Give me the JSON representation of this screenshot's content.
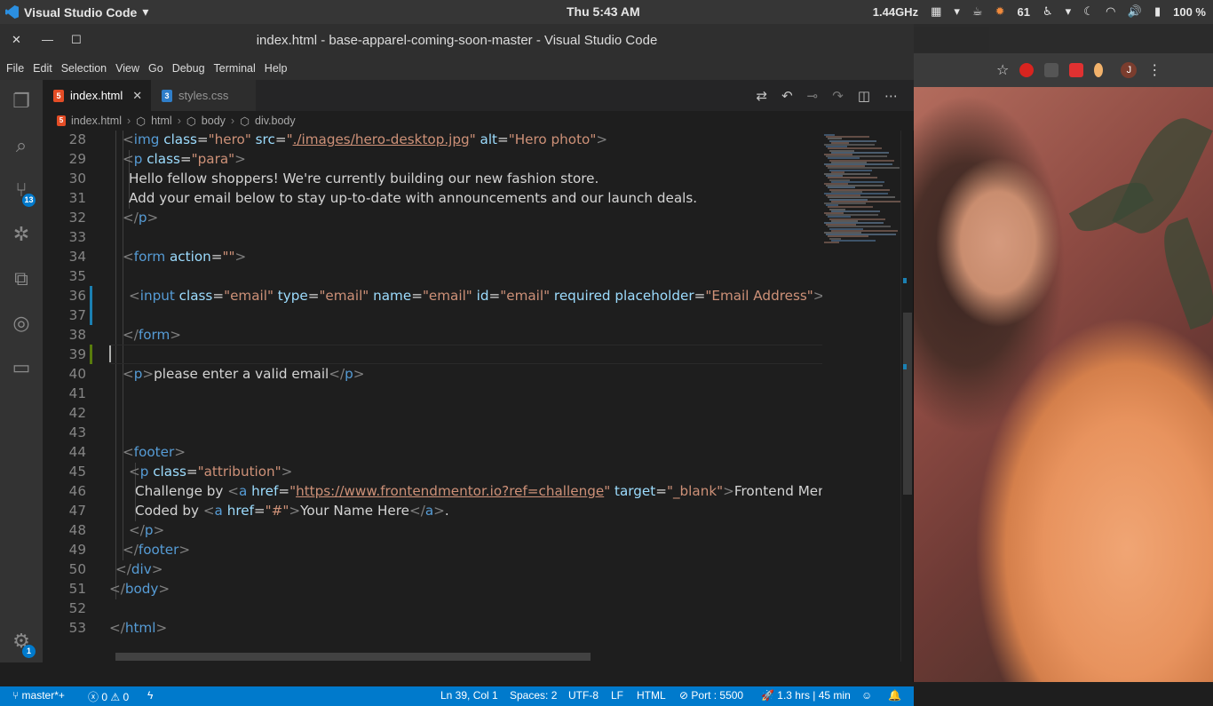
{
  "os": {
    "app_name": "Visual Studio Code",
    "clock": "Thu  5:43 AM",
    "cpu": "1.44GHz",
    "notifications": "61",
    "battery": "100 %"
  },
  "window": {
    "title": "index.html - base-apparel-coming-soon-master - Visual Studio Code",
    "menu": [
      "File",
      "Edit",
      "Selection",
      "View",
      "Go",
      "Debug",
      "Terminal",
      "Help"
    ]
  },
  "activity": {
    "scm_badge": "13",
    "settings_badge": "1"
  },
  "tabs": [
    {
      "label": "index.html",
      "icon": "html5-icon"
    },
    {
      "label": "styles.css",
      "icon": "css3-icon"
    }
  ],
  "breadcrumb": [
    "index.html",
    "html",
    "body",
    "div.body"
  ],
  "editor": {
    "lines": [
      {
        "n": "28",
        "html": "<span class='p'>&lt;</span><span class='t'>img</span> <span class='a'>class</span>=<span class='s'>\"hero\"</span> <span class='a'>src</span>=<span class='s'>\"</span><span class='u'>./images/hero-desktop.jpg</span><span class='s'>\"</span> <span class='a'>alt</span>=<span class='s'>\"Hero photo\"</span><span class='p'>&gt;</span>",
        "indent": 90
      },
      {
        "n": "29",
        "html": "<span class='p'>&lt;</span><span class='t'>p</span> <span class='a'>class</span>=<span class='s'>\"para\"</span><span class='p'>&gt;</span>",
        "indent": 90
      },
      {
        "n": "30",
        "html": "Hello fellow shoppers! We're currently building our new fashion store.",
        "indent": 97
      },
      {
        "n": "31",
        "html": "Add your email below to stay up-to-date with announcements and our launch deals.",
        "indent": 97
      },
      {
        "n": "32",
        "html": "<span class='p'>&lt;/</span><span class='t'>p</span><span class='p'>&gt;</span>",
        "indent": 90
      },
      {
        "n": "33",
        "html": "",
        "indent": 90
      },
      {
        "n": "34",
        "html": "<span class='p'>&lt;</span><span class='t'>form</span> <span class='a'>action</span>=<span class='s'>\"\"</span><span class='p'>&gt;</span>",
        "indent": 90
      },
      {
        "n": "35",
        "html": "",
        "indent": 90
      },
      {
        "n": "36",
        "html": "<span class='p'>&lt;</span><span class='t'>input</span> <span class='a'>class</span>=<span class='s'>\"email\"</span> <span class='a'>type</span>=<span class='s'>\"email\"</span> <span class='a'>name</span>=<span class='s'>\"email\"</span> <span class='a'>id</span>=<span class='s'>\"email\"</span> <span class='a'>required</span> <span class='a'>placeholder</span>=<span class='s'>\"Email Address\"</span><span class='p'>&gt;&lt;</span><span class='t'>a</span> <span class='a'>href</span>=<span class='s'>\"</span>",
        "indent": 97
      },
      {
        "n": "37",
        "html": "",
        "indent": 90
      },
      {
        "n": "38",
        "html": "<span class='p'>&lt;/</span><span class='t'>form</span><span class='p'>&gt;</span>",
        "indent": 90
      },
      {
        "n": "39",
        "html": "",
        "indent": 90
      },
      {
        "n": "40",
        "html": "<span class='p'>&lt;</span><span class='t'>p</span><span class='p'>&gt;</span>please enter a valid email<span class='p'>&lt;/</span><span class='t'>p</span><span class='p'>&gt;</span>",
        "indent": 90
      },
      {
        "n": "41",
        "html": "",
        "indent": 90
      },
      {
        "n": "42",
        "html": "",
        "indent": 90
      },
      {
        "n": "43",
        "html": "",
        "indent": 90
      },
      {
        "n": "44",
        "html": "<span class='p'>&lt;</span><span class='t'>footer</span><span class='p'>&gt;</span>",
        "indent": 90
      },
      {
        "n": "45",
        "html": "<span class='p'>&lt;</span><span class='t'>p</span> <span class='a'>class</span>=<span class='s'>\"attribution\"</span><span class='p'>&gt;</span>",
        "indent": 97
      },
      {
        "n": "46",
        "html": "Challenge by <span class='p'>&lt;</span><span class='t'>a</span> <span class='a'>href</span>=<span class='s'>\"</span><span class='u'>https://www.frontendmentor.io?ref=challenge</span><span class='s'>\"</span> <span class='a'>target</span>=<span class='s'>\"_blank\"</span><span class='p'>&gt;</span>Frontend Mentor<span class='p'>&lt;/</span>",
        "indent": 104
      },
      {
        "n": "47",
        "html": "Coded by <span class='p'>&lt;</span><span class='t'>a</span> <span class='a'>href</span>=<span class='s'>\"#\"</span><span class='p'>&gt;</span>Your Name Here<span class='p'>&lt;/</span><span class='t'>a</span><span class='p'>&gt;</span>.",
        "indent": 104
      },
      {
        "n": "48",
        "html": "<span class='p'>&lt;/</span><span class='t'>p</span><span class='p'>&gt;</span>",
        "indent": 97
      },
      {
        "n": "49",
        "html": "<span class='p'>&lt;/</span><span class='t'>footer</span><span class='p'>&gt;</span>",
        "indent": 90
      },
      {
        "n": "50",
        "html": "<span class='p'>&lt;/</span><span class='t'>div</span><span class='p'>&gt;</span>",
        "indent": 82
      },
      {
        "n": "51",
        "html": "<span class='p'>&lt;/</span><span class='t'>body</span><span class='p'>&gt;</span>",
        "indent": 75
      },
      {
        "n": "52",
        "html": "",
        "indent": 75
      },
      {
        "n": "53",
        "html": "<span class='p'>&lt;/</span><span class='t'>html</span><span class='p'>&gt;</span>",
        "indent": 75
      }
    ],
    "current_line": "39"
  },
  "status": {
    "branch": "master*+",
    "errors": "0",
    "warnings": "0",
    "position": "Ln 39, Col 1",
    "spaces": "Spaces: 2",
    "encoding": "UTF-8",
    "eol": "LF",
    "language": "HTML",
    "port": "Port : 5500",
    "time": "1.3 hrs | 45 min"
  },
  "browser": {
    "profile_initial": "J"
  },
  "colors": {
    "accent": "#007acc",
    "tag": "#569cd6",
    "attr": "#9cdcfe",
    "string": "#ce9178"
  }
}
